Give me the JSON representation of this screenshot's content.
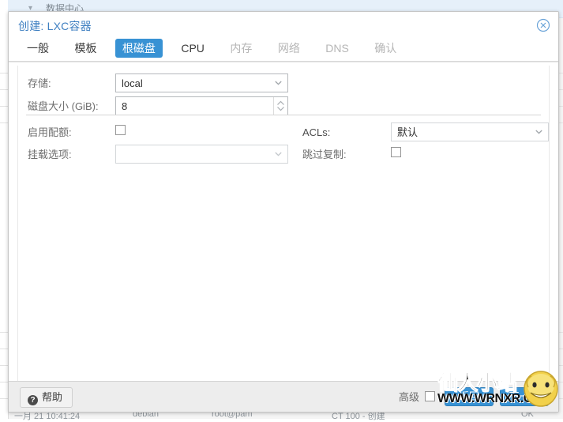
{
  "background": {
    "tree_label": "数据中心",
    "chevron_icon": "chevron-down-icon",
    "log_rows": [
      {
        "time": "一月 21 10:41:24",
        "node": "debian",
        "user": "root@pam",
        "desc": "CT 100 - 创建",
        "status": "OK"
      }
    ]
  },
  "dialog": {
    "title": "创建: LXC容器",
    "close_icon": "close-circle-icon",
    "tabs": [
      {
        "label": "一般",
        "state": "normal"
      },
      {
        "label": "模板",
        "state": "normal"
      },
      {
        "label": "根磁盘",
        "state": "active"
      },
      {
        "label": "CPU",
        "state": "normal"
      },
      {
        "label": "内存",
        "state": "disabled"
      },
      {
        "label": "网络",
        "state": "disabled"
      },
      {
        "label": "DNS",
        "state": "disabled"
      },
      {
        "label": "确认",
        "state": "disabled"
      }
    ],
    "form": {
      "storage": {
        "label": "存储:",
        "value": "local",
        "caret_icon": "chevron-down-icon"
      },
      "disk_size": {
        "label": "磁盘大小 (GiB):",
        "value": "8",
        "spinner_icon": "spinner-updown-icon"
      },
      "enable_quota": {
        "label": "启用配额:",
        "checked": false
      },
      "mount_options": {
        "label": "挂载选项:",
        "value": "",
        "caret_icon": "chevron-down-icon"
      },
      "acls": {
        "label": "ACLs:",
        "value": "默认",
        "caret_icon": "chevron-down-icon"
      },
      "skip_replication": {
        "label": "跳过复制:",
        "checked": false
      }
    },
    "footer": {
      "help_label": "帮助",
      "help_icon": "question-mark-icon",
      "advanced_label": "高级",
      "advanced_checked": false,
      "back_label": "返回",
      "next_label": "下一步"
    }
  },
  "watermark": {
    "title": "仙人小站",
    "url": "WWW.WRNXR.CN",
    "face_icon": "smiley-face-icon"
  },
  "colors": {
    "accent": "#3892d4",
    "title": "#3e7fc1",
    "label": "#6d6d6d",
    "disabled_tab": "#b6b6b6",
    "footer_bg": "#ededed"
  }
}
